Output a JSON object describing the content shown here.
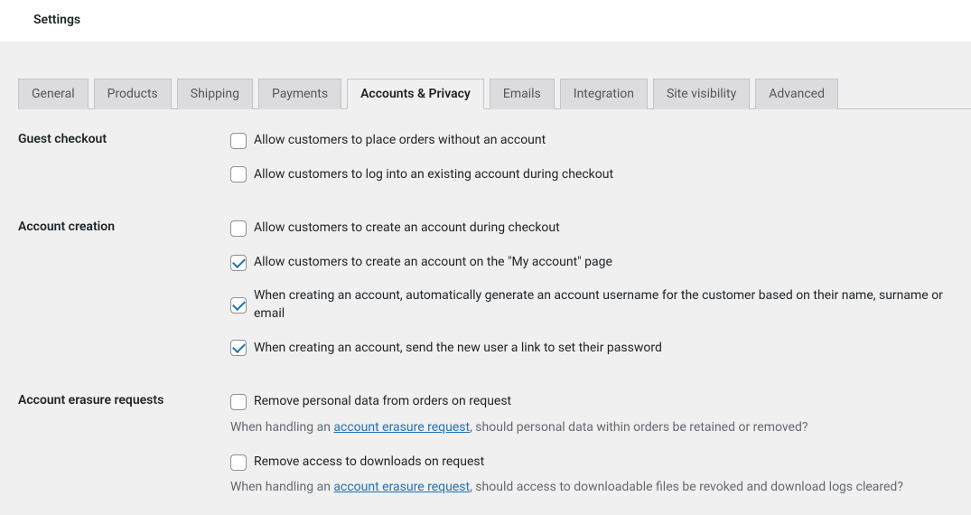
{
  "header": {
    "title": "Settings"
  },
  "tabs": [
    {
      "label": "General",
      "active": false
    },
    {
      "label": "Products",
      "active": false
    },
    {
      "label": "Shipping",
      "active": false
    },
    {
      "label": "Payments",
      "active": false
    },
    {
      "label": "Accounts & Privacy",
      "active": true
    },
    {
      "label": "Emails",
      "active": false
    },
    {
      "label": "Integration",
      "active": false
    },
    {
      "label": "Site visibility",
      "active": false
    },
    {
      "label": "Advanced",
      "active": false
    }
  ],
  "sections": {
    "guest_checkout": {
      "title": "Guest checkout",
      "options": [
        {
          "label": "Allow customers to place orders without an account",
          "checked": false
        },
        {
          "label": "Allow customers to log into an existing account during checkout",
          "checked": false
        }
      ]
    },
    "account_creation": {
      "title": "Account creation",
      "options": [
        {
          "label": "Allow customers to create an account during checkout",
          "checked": false
        },
        {
          "label": "Allow customers to create an account on the \"My account\" page",
          "checked": true
        },
        {
          "label": "When creating an account, automatically generate an account username for the customer based on their name, surname or email",
          "checked": true
        },
        {
          "label": "When creating an account, send the new user a link to set their password",
          "checked": true
        }
      ]
    },
    "account_erasure": {
      "title": "Account erasure requests",
      "options": [
        {
          "label": "Remove personal data from orders on request",
          "checked": false,
          "desc_before": "When handling an ",
          "desc_link": "account erasure request",
          "desc_after": ", should personal data within orders be retained or removed?"
        },
        {
          "label": "Remove access to downloads on request",
          "checked": false,
          "desc_before": "When handling an ",
          "desc_link": "account erasure request",
          "desc_after": ", should access to downloadable files be revoked and download logs cleared?"
        }
      ]
    }
  }
}
